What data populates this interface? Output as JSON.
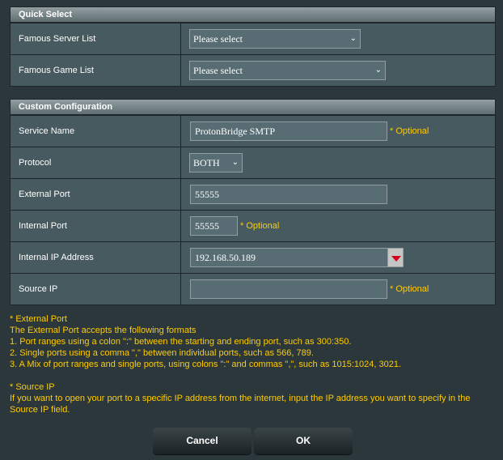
{
  "quick_select": {
    "title": "Quick Select",
    "server_label": "Famous Server List",
    "server_value": "Please select",
    "game_label": "Famous Game List",
    "game_value": "Please select"
  },
  "custom": {
    "title": "Custom Configuration",
    "service_name_label": "Service Name",
    "service_name_value": "ProtonBridge SMTP",
    "optional": "* Optional",
    "protocol_label": "Protocol",
    "protocol_value": "BOTH",
    "external_port_label": "External Port",
    "external_port_value": "55555",
    "internal_port_label": "Internal Port",
    "internal_port_value": "55555",
    "internal_ip_label": "Internal IP Address",
    "internal_ip_value": "192.168.50.189",
    "source_ip_label": "Source IP",
    "source_ip_value": ""
  },
  "notes": {
    "external_title": "* External Port",
    "external_intro": "The External Port accepts the following formats",
    "external_1": "1. Port ranges using a colon \":\" between the starting and ending port, such as 300:350.",
    "external_2": "2. Single ports using a comma \",\" between individual ports, such as 566, 789.",
    "external_3": "3. A Mix of port ranges and single ports, using colons \":\" and commas \",\", such as 1015:1024, 3021.",
    "source_title": "* Source IP",
    "source_text": "If you want to open your port to a specific IP address from the internet, input the IP address you want to specify in the Source IP field."
  },
  "buttons": {
    "cancel": "Cancel",
    "ok": "OK"
  },
  "colors": {
    "optional_text": "#ffcc00",
    "row_bg": "#475a5f",
    "page_bg": "#2b373b"
  }
}
